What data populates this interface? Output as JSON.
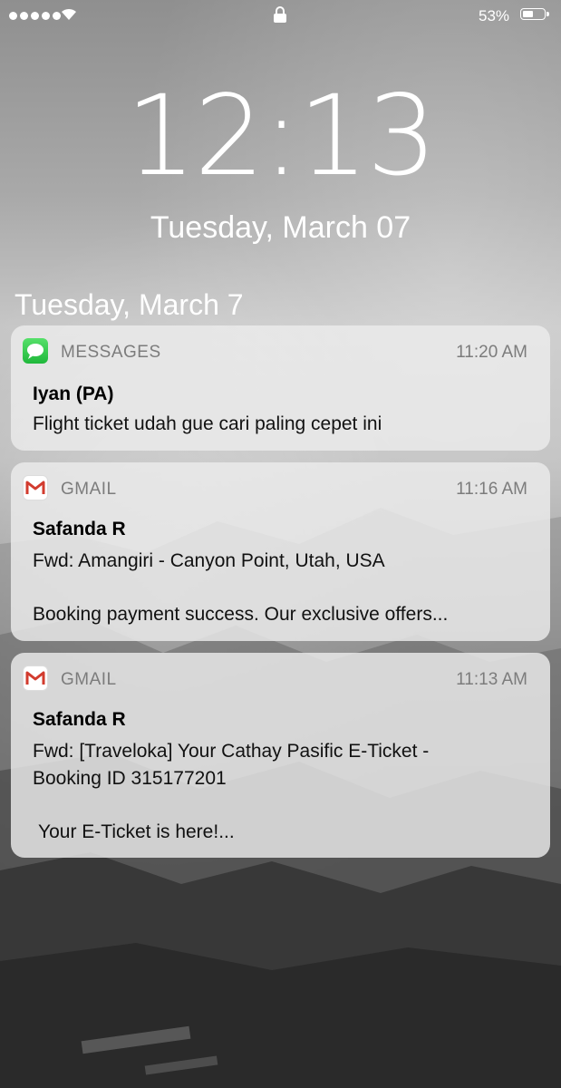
{
  "status_bar": {
    "battery": "53%"
  },
  "lock_screen": {
    "time": "12:13",
    "date": "Tuesday, March 07"
  },
  "notification_section": "Tuesday, March 7",
  "notifications": [
    {
      "app": "MESSAGES",
      "time": "11:20 AM",
      "icon": "messages-icon",
      "title": "Iyan (PA)",
      "body": "Flight ticket udah gue cari paling cepet ini"
    },
    {
      "app": "GMAIL",
      "time": "11:16 AM",
      "icon": "gmail-icon",
      "title": "Safanda R",
      "subject": "Fwd: Amangiri - Canyon Point, Utah, USA",
      "body": "Booking payment success. Our exclusive offers..."
    },
    {
      "app": "GMAIL",
      "time": "11:13 AM",
      "icon": "gmail-icon",
      "title": "Safanda R",
      "subject": "Fwd: [Traveloka] Your Cathay Pasific E-Ticket - Booking ID 315177201",
      "body": "Your E-Ticket is here!..."
    }
  ]
}
